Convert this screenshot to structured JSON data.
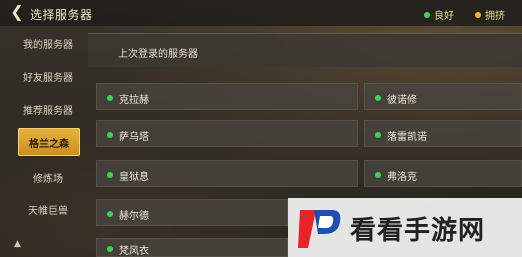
{
  "header": {
    "title": "选择服务器",
    "legend": [
      {
        "label": "良好",
        "color": "#3bd356"
      },
      {
        "label": "拥挤",
        "color": "#f0b52a"
      }
    ]
  },
  "sidebar": {
    "items": [
      {
        "label": "我的服务器"
      },
      {
        "label": "好友服务器"
      },
      {
        "label": "推荐服务器"
      },
      {
        "label": "格兰之森",
        "active": true
      },
      {
        "label": "修炼场"
      },
      {
        "label": "天帷巨兽"
      }
    ]
  },
  "main": {
    "section_title": "上次登录的服务器",
    "servers": [
      {
        "name": "克拉赫",
        "status": "良好"
      },
      {
        "name": "彼诺修",
        "status": "良好"
      },
      {
        "name": "萨乌塔",
        "status": "良好"
      },
      {
        "name": "落雷凯诺",
        "status": "良好"
      },
      {
        "name": "皇狱息",
        "status": "良好"
      },
      {
        "name": "弗洛克",
        "status": "良好"
      },
      {
        "name": "赫尔德",
        "status": "良好"
      },
      {
        "name": "梵风衣",
        "status": "良好"
      }
    ]
  },
  "watermark": {
    "text": "看看手游网"
  }
}
